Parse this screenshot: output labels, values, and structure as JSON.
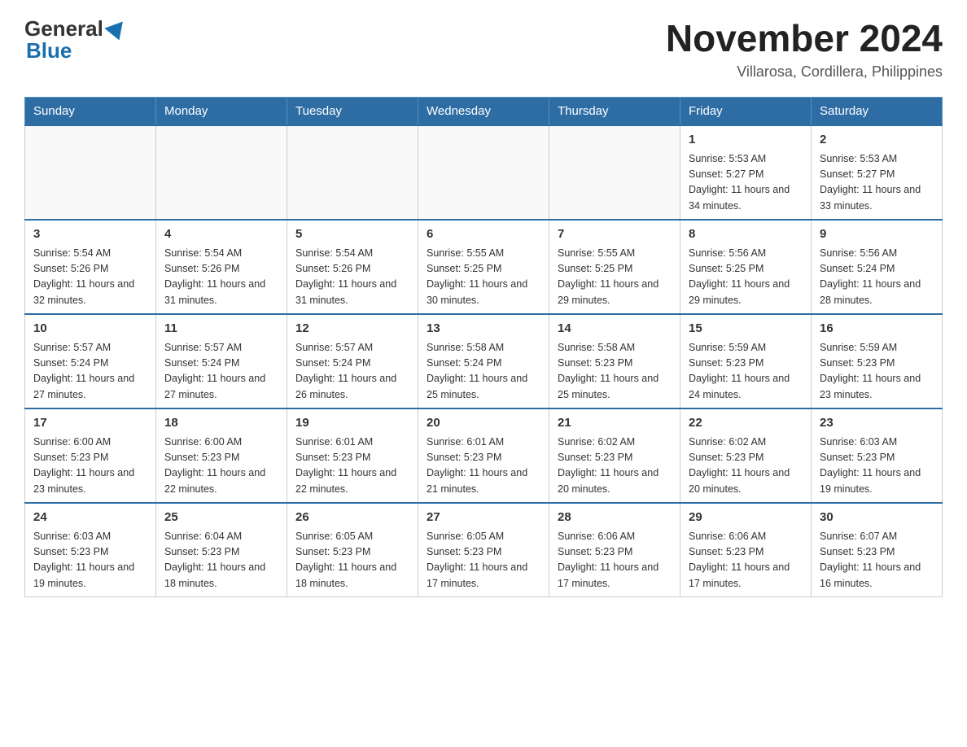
{
  "logo": {
    "general": "General",
    "blue": "Blue"
  },
  "header": {
    "title": "November 2024",
    "subtitle": "Villarosa, Cordillera, Philippines"
  },
  "weekdays": [
    "Sunday",
    "Monday",
    "Tuesday",
    "Wednesday",
    "Thursday",
    "Friday",
    "Saturday"
  ],
  "weeks": [
    [
      {
        "day": "",
        "info": ""
      },
      {
        "day": "",
        "info": ""
      },
      {
        "day": "",
        "info": ""
      },
      {
        "day": "",
        "info": ""
      },
      {
        "day": "",
        "info": ""
      },
      {
        "day": "1",
        "info": "Sunrise: 5:53 AM\nSunset: 5:27 PM\nDaylight: 11 hours and 34 minutes."
      },
      {
        "day": "2",
        "info": "Sunrise: 5:53 AM\nSunset: 5:27 PM\nDaylight: 11 hours and 33 minutes."
      }
    ],
    [
      {
        "day": "3",
        "info": "Sunrise: 5:54 AM\nSunset: 5:26 PM\nDaylight: 11 hours and 32 minutes."
      },
      {
        "day": "4",
        "info": "Sunrise: 5:54 AM\nSunset: 5:26 PM\nDaylight: 11 hours and 31 minutes."
      },
      {
        "day": "5",
        "info": "Sunrise: 5:54 AM\nSunset: 5:26 PM\nDaylight: 11 hours and 31 minutes."
      },
      {
        "day": "6",
        "info": "Sunrise: 5:55 AM\nSunset: 5:25 PM\nDaylight: 11 hours and 30 minutes."
      },
      {
        "day": "7",
        "info": "Sunrise: 5:55 AM\nSunset: 5:25 PM\nDaylight: 11 hours and 29 minutes."
      },
      {
        "day": "8",
        "info": "Sunrise: 5:56 AM\nSunset: 5:25 PM\nDaylight: 11 hours and 29 minutes."
      },
      {
        "day": "9",
        "info": "Sunrise: 5:56 AM\nSunset: 5:24 PM\nDaylight: 11 hours and 28 minutes."
      }
    ],
    [
      {
        "day": "10",
        "info": "Sunrise: 5:57 AM\nSunset: 5:24 PM\nDaylight: 11 hours and 27 minutes."
      },
      {
        "day": "11",
        "info": "Sunrise: 5:57 AM\nSunset: 5:24 PM\nDaylight: 11 hours and 27 minutes."
      },
      {
        "day": "12",
        "info": "Sunrise: 5:57 AM\nSunset: 5:24 PM\nDaylight: 11 hours and 26 minutes."
      },
      {
        "day": "13",
        "info": "Sunrise: 5:58 AM\nSunset: 5:24 PM\nDaylight: 11 hours and 25 minutes."
      },
      {
        "day": "14",
        "info": "Sunrise: 5:58 AM\nSunset: 5:23 PM\nDaylight: 11 hours and 25 minutes."
      },
      {
        "day": "15",
        "info": "Sunrise: 5:59 AM\nSunset: 5:23 PM\nDaylight: 11 hours and 24 minutes."
      },
      {
        "day": "16",
        "info": "Sunrise: 5:59 AM\nSunset: 5:23 PM\nDaylight: 11 hours and 23 minutes."
      }
    ],
    [
      {
        "day": "17",
        "info": "Sunrise: 6:00 AM\nSunset: 5:23 PM\nDaylight: 11 hours and 23 minutes."
      },
      {
        "day": "18",
        "info": "Sunrise: 6:00 AM\nSunset: 5:23 PM\nDaylight: 11 hours and 22 minutes."
      },
      {
        "day": "19",
        "info": "Sunrise: 6:01 AM\nSunset: 5:23 PM\nDaylight: 11 hours and 22 minutes."
      },
      {
        "day": "20",
        "info": "Sunrise: 6:01 AM\nSunset: 5:23 PM\nDaylight: 11 hours and 21 minutes."
      },
      {
        "day": "21",
        "info": "Sunrise: 6:02 AM\nSunset: 5:23 PM\nDaylight: 11 hours and 20 minutes."
      },
      {
        "day": "22",
        "info": "Sunrise: 6:02 AM\nSunset: 5:23 PM\nDaylight: 11 hours and 20 minutes."
      },
      {
        "day": "23",
        "info": "Sunrise: 6:03 AM\nSunset: 5:23 PM\nDaylight: 11 hours and 19 minutes."
      }
    ],
    [
      {
        "day": "24",
        "info": "Sunrise: 6:03 AM\nSunset: 5:23 PM\nDaylight: 11 hours and 19 minutes."
      },
      {
        "day": "25",
        "info": "Sunrise: 6:04 AM\nSunset: 5:23 PM\nDaylight: 11 hours and 18 minutes."
      },
      {
        "day": "26",
        "info": "Sunrise: 6:05 AM\nSunset: 5:23 PM\nDaylight: 11 hours and 18 minutes."
      },
      {
        "day": "27",
        "info": "Sunrise: 6:05 AM\nSunset: 5:23 PM\nDaylight: 11 hours and 17 minutes."
      },
      {
        "day": "28",
        "info": "Sunrise: 6:06 AM\nSunset: 5:23 PM\nDaylight: 11 hours and 17 minutes."
      },
      {
        "day": "29",
        "info": "Sunrise: 6:06 AM\nSunset: 5:23 PM\nDaylight: 11 hours and 17 minutes."
      },
      {
        "day": "30",
        "info": "Sunrise: 6:07 AM\nSunset: 5:23 PM\nDaylight: 11 hours and 16 minutes."
      }
    ]
  ]
}
